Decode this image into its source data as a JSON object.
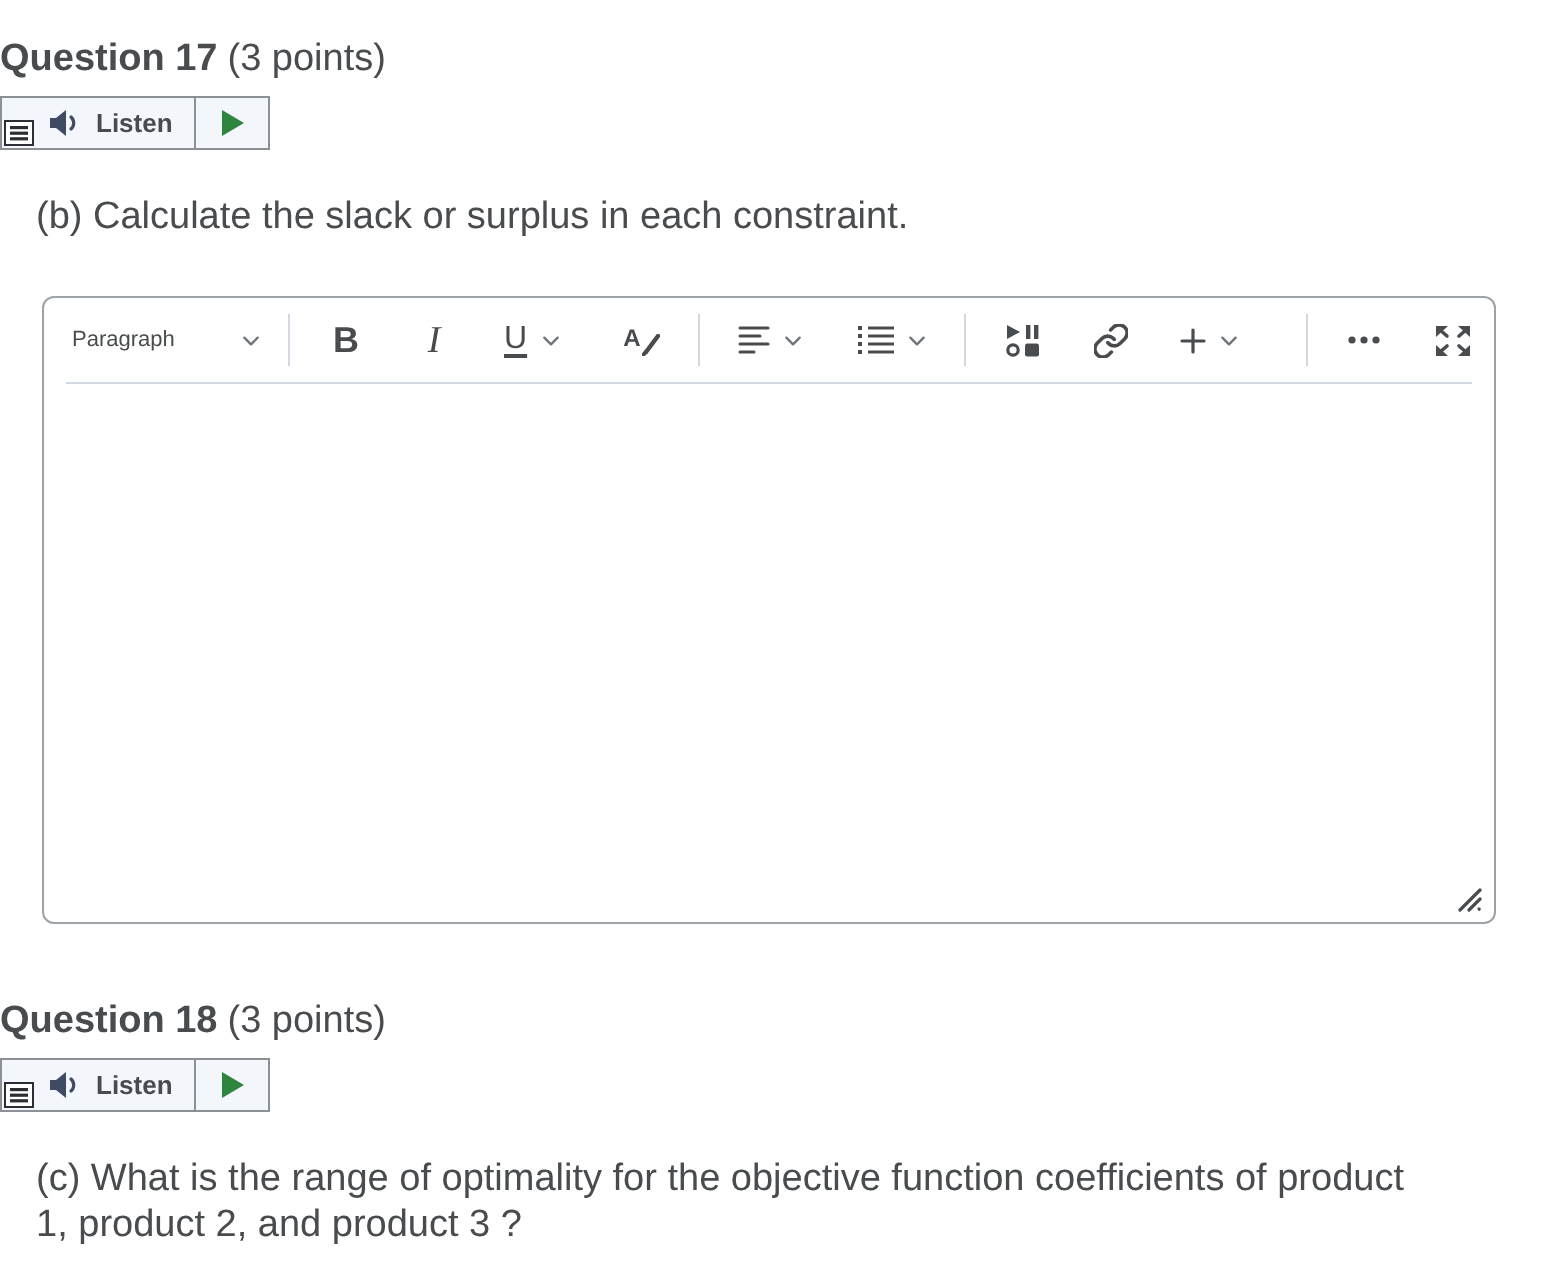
{
  "questions": [
    {
      "number": "Question 17",
      "points": "(3 points)",
      "listen": {
        "label": "Listen"
      },
      "prompt": "(b) Calculate the slack or surplus in each constraint.",
      "editor": {
        "toolbar_groups": [
          [
            {
              "kind": "format",
              "label": "Paragraph",
              "dropdown": true
            }
          ],
          [
            {
              "kind": "bold",
              "glyph": "B",
              "dropdown": false
            },
            {
              "kind": "italic",
              "glyph": "I",
              "dropdown": false
            },
            {
              "kind": "underline",
              "glyph": "U",
              "dropdown": true
            },
            {
              "kind": "text-color",
              "glyph": "A",
              "dropdown": false
            }
          ],
          [
            {
              "kind": "align",
              "dropdown": true
            },
            {
              "kind": "list",
              "dropdown": true
            }
          ],
          [
            {
              "kind": "media",
              "dropdown": false
            },
            {
              "kind": "link",
              "dropdown": false
            },
            {
              "kind": "insert",
              "dropdown": true
            }
          ],
          [
            {
              "kind": "more",
              "dropdown": false
            },
            {
              "kind": "fullscreen",
              "dropdown": false
            }
          ]
        ]
      }
    },
    {
      "number": "Question 18",
      "points": "(3 points)",
      "listen": {
        "label": "Listen"
      },
      "prompt": "(c) What is the range of optimality for the objective function coefficients of product 1, product 2, and product 3 ?"
    }
  ]
}
